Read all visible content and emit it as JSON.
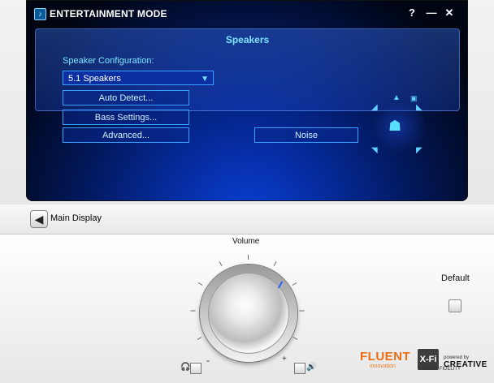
{
  "window": {
    "title": "ENTERTAINMENT MODE",
    "help_glyph": "?",
    "minimize_glyph": "—",
    "close_glyph": "✕",
    "title_icon": "music-note-icon"
  },
  "speakers_panel": {
    "title": "Speakers",
    "config_label": "Speaker Configuration:",
    "config_value": "5.1 Speakers",
    "auto_detect_label": "Auto Detect...",
    "bass_settings_label": "Bass Settings...",
    "advanced_label": "Advanced...",
    "noise_label": "Noise"
  },
  "nav": {
    "back_label": "Main Display",
    "back_icon": "arrow-left-icon"
  },
  "controls": {
    "volume_label": "Volume",
    "default_label": "Default",
    "minus": "-",
    "plus": "+",
    "headphones_icon": "headphones-icon",
    "speaker_icon": "speaker-icon"
  },
  "branding": {
    "fluent_text": "FLUENT",
    "fluent_sub": "innovation",
    "xfi_text": "X-Fi",
    "xfi_sub": "XTREME FIDELITY",
    "creative_sub": "powered by",
    "creative_text": "CREATIVE"
  },
  "colors": {
    "accent": "#7fe4ff",
    "panel_border": "#3aa0ff",
    "brand_orange": "#f06b12"
  }
}
